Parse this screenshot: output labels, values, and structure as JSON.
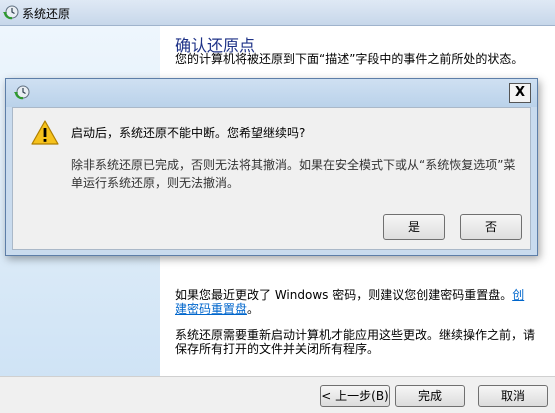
{
  "window": {
    "title": "系统还原"
  },
  "wizard": {
    "heading": "确认还原点",
    "description": "您的计算机将被还原到下面“描述”字段中的事件之前所处的状态。",
    "password_note": "如果您最近更改了 Windows 密码，则建议您创建密码重置盘。",
    "password_link": "创建密码重置盘",
    "password_note_end": "。",
    "restart_note": "系统还原需要重新启动计算机才能应用这些更改。继续操作之前，请保存所有打开的文件并关闭所有程序。"
  },
  "footer": {
    "back_label": "< 上一步(B)",
    "finish_label": "完成",
    "cancel_label": "取消"
  },
  "dialog": {
    "close_label": "X",
    "question": "启动后，系统还原不能中断。您希望继续吗?",
    "detail": "除非系统还原已完成，否则无法将其撤消。如果在安全模式下或从“系统恢复选项”菜单运行系统还原，则无法撤消。",
    "yes_label": "是",
    "no_label": "否"
  },
  "icons": {
    "app": "system-restore-icon",
    "warning": "warning-icon"
  },
  "colors": {
    "heading": "#1e3287",
    "link": "#0066cc",
    "dialog_frame": "#c9dbee"
  }
}
